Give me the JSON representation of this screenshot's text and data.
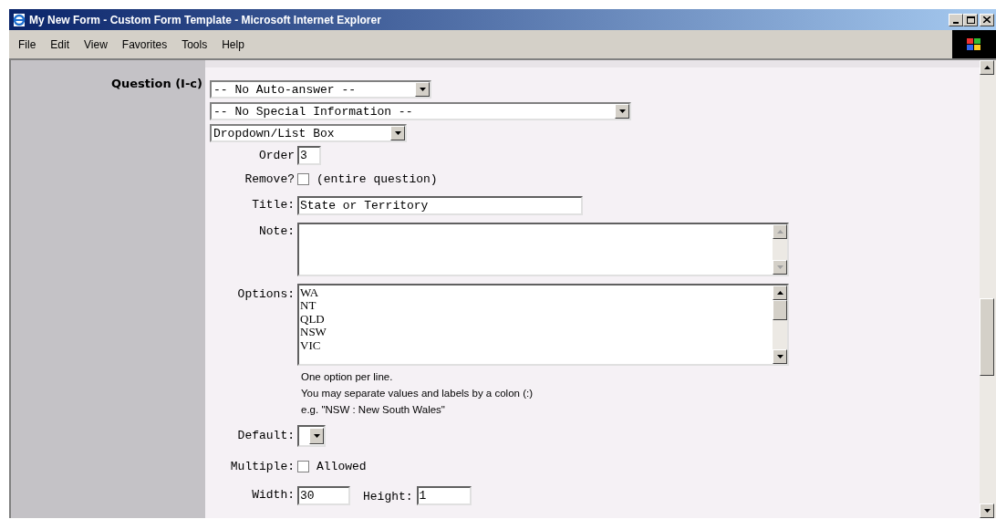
{
  "window": {
    "title": "My New Form - Custom Form Template - Microsoft Internet Explorer"
  },
  "menu": [
    {
      "label": "File"
    },
    {
      "label": "Edit"
    },
    {
      "label": "View"
    },
    {
      "label": "Favorites"
    },
    {
      "label": "Tools"
    },
    {
      "label": "Help"
    }
  ],
  "question": {
    "label": "Question (I-c)",
    "selects": [
      "-- No Auto-answer --",
      "-- No Special Information --",
      "Dropdown/List Box"
    ],
    "order": {
      "label": "Order",
      "value": "3"
    },
    "remove": {
      "label": "Remove?",
      "checked": false,
      "note": "(entire question)"
    },
    "title": {
      "label": "Title:",
      "value": "State or Territory"
    },
    "note": {
      "label": "Note:"
    },
    "options": {
      "label": "Options:",
      "lines": [
        "WA",
        "NT",
        "QLD",
        "NSW",
        "VIC"
      ]
    },
    "help": [
      "One option per line.",
      "You may separate values and labels by a colon (:)",
      "e.g. \"NSW : New South Wales\""
    ],
    "default": {
      "label": "Default:"
    },
    "multiple": {
      "label": "Multiple:",
      "checked": false,
      "note": "Allowed"
    },
    "width": {
      "label": "Width:",
      "value": "30"
    },
    "height": {
      "label": "Height:",
      "value": "1"
    }
  }
}
